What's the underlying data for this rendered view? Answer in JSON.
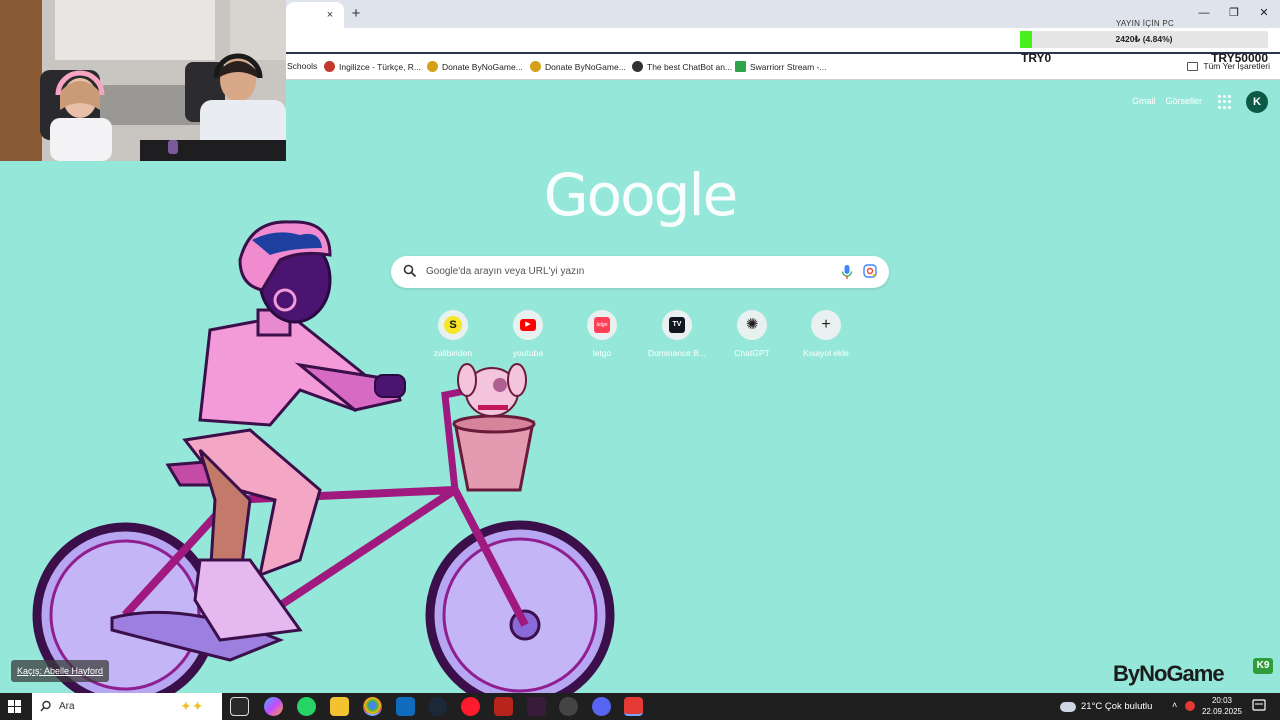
{
  "browser": {
    "tab_close": "×",
    "new_tab": "+",
    "window_controls": {
      "minimize": "—",
      "restore": "❐",
      "close": "✕"
    },
    "bookmarks": [
      {
        "label": "Schools",
        "icon": "w3schools-icon",
        "color": "#ffffff"
      },
      {
        "label": "Ingilizce - Türkçe, R...",
        "icon": "dictionary-icon",
        "color": "#c0392b"
      },
      {
        "label": "Donate ByNoGame...",
        "icon": "bynogame-icon",
        "color": "#d4a017"
      },
      {
        "label": "Donate ByNoGame...",
        "icon": "bynogame-icon",
        "color": "#d4a017"
      },
      {
        "label": "The best ChatBot an...",
        "icon": "chatbot-icon",
        "color": "#333333"
      },
      {
        "label": "Swarriorr Stream -...",
        "icon": "kick-icon",
        "color": "#2fa34a"
      }
    ],
    "all_bookmarks": "Tüm Yer İşaretleri"
  },
  "stream_goal": {
    "title": "YAYIN İÇİN PC",
    "progress_text": "2420₺ (4.84%)",
    "progress_fraction": 0.0484,
    "min_label": "TRY0",
    "max_label": "TRY50000",
    "fill_color": "#48f020"
  },
  "google": {
    "top_links": [
      "Gmail",
      "Görseller"
    ],
    "avatar_letter": "K",
    "logo_text": "Google",
    "search_placeholder": "Google'da arayın veya URL'yi yazın",
    "shortcuts": [
      {
        "label": "zalibiriden",
        "glyph": "S",
        "bg": "#f5e62a",
        "fg": "#111111",
        "icon": "s-icon"
      },
      {
        "label": "youtube",
        "glyph": "▶",
        "bg": "#ff0000",
        "fg": "#ffffff",
        "icon": "youtube-icon"
      },
      {
        "label": "letgo",
        "glyph": "letgo",
        "bg": "#ff3f55",
        "fg": "#ffffff",
        "icon": "letgo-icon"
      },
      {
        "label": "Dominance B...",
        "glyph": "TV",
        "bg": "#131722",
        "fg": "#ffffff",
        "icon": "tradingview-icon"
      },
      {
        "label": "ChatGPT",
        "glyph": "✺",
        "bg": "#e9f1f0",
        "fg": "#222222",
        "icon": "chatgpt-icon"
      },
      {
        "label": "Kısayol ekle",
        "glyph": "+",
        "bg": "#e9f1f0",
        "fg": "#222222",
        "icon": "plus-icon"
      }
    ]
  },
  "overlay": {
    "song": "Kaçış: Abelle Hayford",
    "brand": "ByNoGame",
    "brand_badge": "K9"
  },
  "taskbar": {
    "search_text": "Ara",
    "weather": "21°C  Çok bulutlu",
    "time": "20:03",
    "date": "22.09.2025"
  }
}
